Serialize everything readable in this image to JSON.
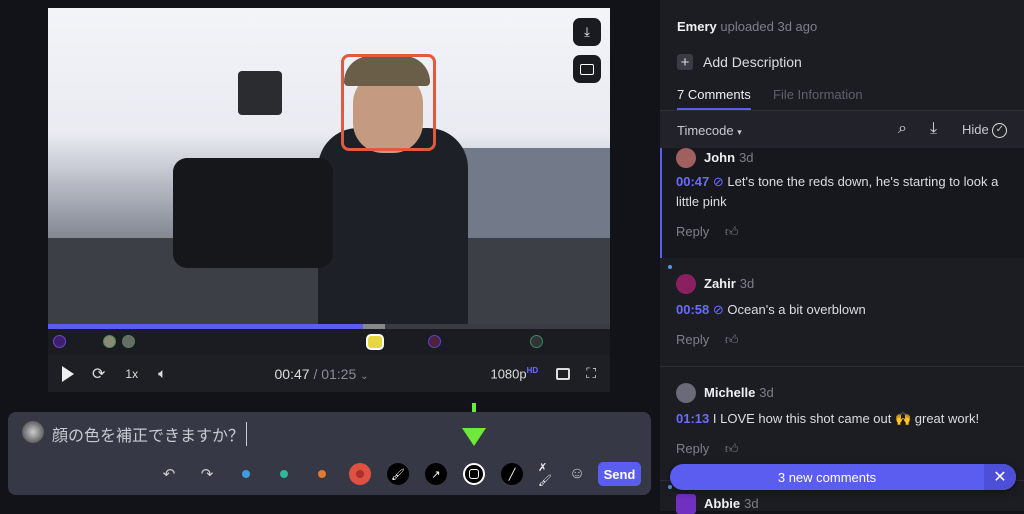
{
  "player": {
    "current_time": "00:47",
    "duration": "/ 01:25",
    "speed": "1x",
    "quality": "1080p",
    "quality_badge": "HD",
    "progress_percent": 56
  },
  "composer": {
    "text": "顔の色を補正できますか？",
    "send_label": "Send",
    "colors": [
      "#3f9ae0",
      "#2fb89a",
      "#e07a30",
      "#e05040"
    ]
  },
  "panel": {
    "uploader": "Emery",
    "uploaded": "uploaded 3d ago",
    "add_description": "Add Description",
    "tabs": [
      {
        "label": "7 Comments",
        "active": true
      },
      {
        "label": "File Information",
        "active": false
      }
    ],
    "sort_label": "Timecode",
    "hide_label": "Hide",
    "comments": [
      {
        "name": "John",
        "ago": "3d",
        "timecode": "00:47",
        "text": "Let's tone the reds down, he's starting to look a little pink",
        "reply": "Reply",
        "annotated": true
      },
      {
        "name": "Zahir",
        "ago": "3d",
        "timecode": "00:58",
        "text": "Ocean's a bit overblown",
        "reply": "Reply",
        "annotated": true
      },
      {
        "name": "Michelle",
        "ago": "3d",
        "timecode": "01:13",
        "text": "I LOVE how this shot came out 🙌 great work!",
        "reply": "Reply",
        "annotated": false
      },
      {
        "name": "Abbie",
        "ago": "3d"
      }
    ],
    "new_comments_label": "3 new comments"
  },
  "accent": "#5b5cf0"
}
